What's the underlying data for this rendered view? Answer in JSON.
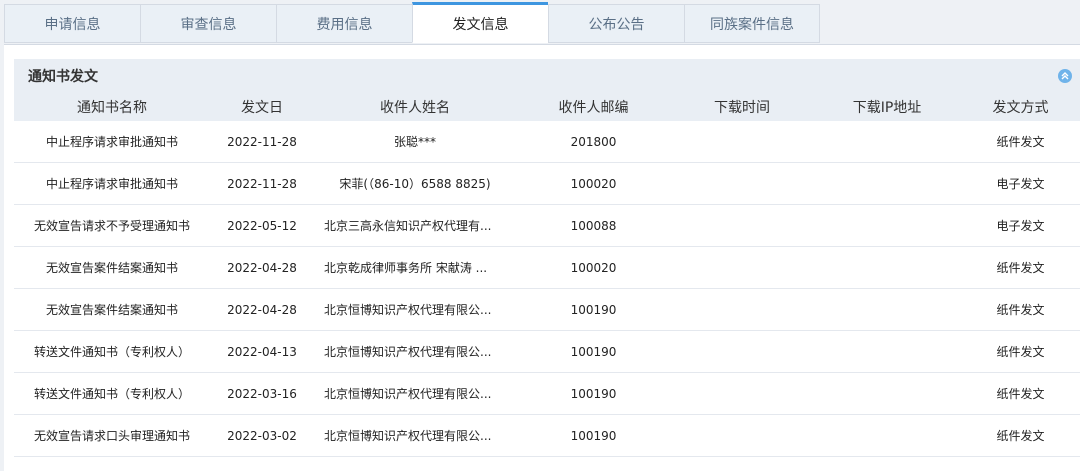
{
  "tabs": [
    {
      "label": "申请信息",
      "active": false
    },
    {
      "label": "审查信息",
      "active": false
    },
    {
      "label": "费用信息",
      "active": false
    },
    {
      "label": "发文信息",
      "active": true
    },
    {
      "label": "公布公告",
      "active": false
    },
    {
      "label": "同族案件信息",
      "active": false
    }
  ],
  "section": {
    "title": "通知书发文",
    "collapse_icon": "chevron-up-double-icon"
  },
  "table": {
    "headers": [
      "通知书名称",
      "发文日",
      "收件人姓名",
      "收件人邮编",
      "下载时间",
      "下载IP地址",
      "发文方式"
    ],
    "rows": [
      [
        "中止程序请求审批通知书",
        "2022-11-28",
        "张聪***",
        "201800",
        "",
        "",
        "纸件发文"
      ],
      [
        "中止程序请求审批通知书",
        "2022-11-28",
        "宋菲(（86-10）6588 8825)",
        "100020",
        "",
        "",
        "电子发文"
      ],
      [
        "无效宣告请求不予受理通知书",
        "2022-05-12",
        "北京三高永信知识产权代理有...",
        "100088",
        "",
        "",
        "电子发文"
      ],
      [
        "无效宣告案件结案通知书",
        "2022-04-28",
        "北京乾成律师事务所 宋献涛 ...",
        "100020",
        "",
        "",
        "纸件发文"
      ],
      [
        "无效宣告案件结案通知书",
        "2022-04-28",
        "北京恒博知识产权代理有限公...",
        "100190",
        "",
        "",
        "纸件发文"
      ],
      [
        "转送文件通知书（专利权人）",
        "2022-04-13",
        "北京恒博知识产权代理有限公...",
        "100190",
        "",
        "",
        "纸件发文"
      ],
      [
        "转送文件通知书（专利权人）",
        "2022-03-16",
        "北京恒博知识产权代理有限公...",
        "100190",
        "",
        "",
        "纸件发文"
      ],
      [
        "无效宣告请求口头审理通知书",
        "2022-03-02",
        "北京恒博知识产权代理有限公...",
        "100190",
        "",
        "",
        "纸件发文"
      ]
    ]
  },
  "colors": {
    "accent": "#3e96e0",
    "header_bg": "#e9eef4",
    "tab_bg": "#eaf0f6"
  }
}
